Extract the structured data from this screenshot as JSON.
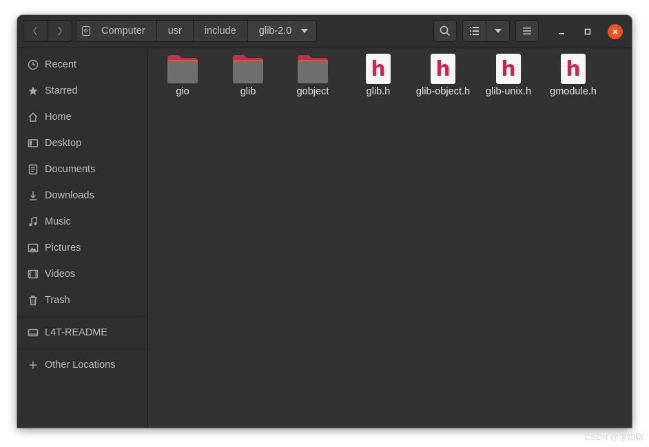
{
  "window": {
    "accent": "#e95420",
    "background": "#2d2d2d"
  },
  "nav": {
    "back_icon": "chevron-left-icon",
    "forward_icon": "chevron-right-icon"
  },
  "pathbar": {
    "crumbs": [
      "Computer",
      "usr",
      "include",
      "glib-2.0"
    ]
  },
  "toolbar": {
    "search_icon": "search-icon",
    "view_icon": "list-view-icon",
    "view_dropdown_icon": "caret-down-icon",
    "menu_icon": "hamburger-icon"
  },
  "sidebar": {
    "items": [
      {
        "label": "Recent",
        "icon": "clock-icon"
      },
      {
        "label": "Starred",
        "icon": "star-icon"
      },
      {
        "label": "Home",
        "icon": "home-icon"
      },
      {
        "label": "Desktop",
        "icon": "desktop-icon"
      },
      {
        "label": "Documents",
        "icon": "document-icon"
      },
      {
        "label": "Downloads",
        "icon": "download-icon"
      },
      {
        "label": "Music",
        "icon": "music-icon"
      },
      {
        "label": "Pictures",
        "icon": "picture-icon"
      },
      {
        "label": "Videos",
        "icon": "video-icon"
      },
      {
        "label": "Trash",
        "icon": "trash-icon"
      }
    ],
    "devices": [
      {
        "label": "L4T-README",
        "icon": "drive-icon"
      }
    ],
    "other": {
      "label": "Other Locations",
      "icon": "plus-icon"
    }
  },
  "files": [
    {
      "name": "gio",
      "type": "folder"
    },
    {
      "name": "glib",
      "type": "folder"
    },
    {
      "name": "gobject",
      "type": "folder"
    },
    {
      "name": "glib.h",
      "type": "header",
      "glyph": "h"
    },
    {
      "name": "glib-object.h",
      "type": "header",
      "glyph": "h"
    },
    {
      "name": "glib-unix.h",
      "type": "header",
      "glyph": "h"
    },
    {
      "name": "gmodule.h",
      "type": "header",
      "glyph": "h"
    }
  ],
  "watermark": "CSDN @李知聊"
}
